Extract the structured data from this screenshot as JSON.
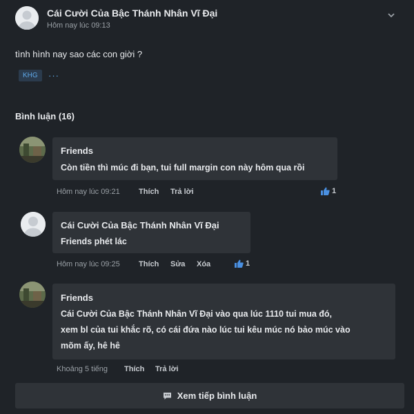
{
  "post": {
    "author": "Cái Cười Của Bậc Thánh Nhân Vĩ Đại",
    "time": "Hôm nay lúc 09:13",
    "body": "tình hình nay sao các con giời ?",
    "tags": [
      "KHG"
    ],
    "tags_more": "···",
    "menu_icon": "chevron-down-icon"
  },
  "comments_section": {
    "title": "Bình luận (16)",
    "comments": [
      {
        "author": "Friends",
        "text": "Còn tiền thì múc đi bạn, tui full margin con này hôm qua rồi",
        "time": "Hôm nay lúc 09:21",
        "actions": [
          "Thích",
          "Trả lời"
        ],
        "likes": "1",
        "avatar": "photo"
      },
      {
        "author": "Cái Cười Của Bậc Thánh Nhân Vĩ Đại",
        "text": "Friends  phét lác",
        "time": "Hôm nay lúc 09:25",
        "actions": [
          "Thích",
          "Sửa",
          "Xóa"
        ],
        "likes": "1",
        "avatar": "blank"
      },
      {
        "author": "Friends",
        "text_lines": [
          "Cái Cười Của Bậc Thánh Nhân Vĩ Đại vào qua lúc 1110 tui mua đó,",
          "xem bl của tui khắc rõ, có cái đứa nào lúc tui kêu múc nó bảo múc vào",
          "mõm ấy, hê hê"
        ],
        "time": "Khoảng 5 tiếng",
        "actions": [
          "Thích",
          "Trả lời"
        ],
        "avatar": "photo"
      }
    ],
    "load_more": "Xem tiếp bình luận"
  },
  "colors": {
    "background": "#1f2328",
    "bubble": "#2f3338",
    "tag_text": "#5fa8e8",
    "like_blue": "#4a90e2"
  }
}
